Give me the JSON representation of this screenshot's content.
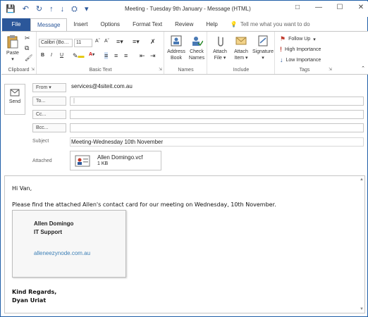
{
  "window": {
    "title": "Meeting - Tuesday 9th January  -  Message (HTML)",
    "controls": [
      "restore-down-icon",
      "minimize-icon",
      "maximize-icon",
      "close-icon"
    ]
  },
  "qat": [
    "save-icon",
    "undo-icon",
    "redo-icon",
    "up-arrow-icon",
    "down-arrow-icon",
    "attach-icon",
    "more-icon"
  ],
  "tabs": [
    {
      "label": "File"
    },
    {
      "label": "Message"
    },
    {
      "label": "Insert"
    },
    {
      "label": "Options"
    },
    {
      "label": "Format Text"
    },
    {
      "label": "Review"
    },
    {
      "label": "Help"
    }
  ],
  "tell_me": "Tell me what you want to do",
  "ribbon": {
    "clipboard": {
      "label": "Clipboard",
      "paste": "Paste"
    },
    "basic_text": {
      "label": "Basic Text",
      "font": "Calibri (Bo…",
      "size": "11"
    },
    "names": {
      "label": "Names",
      "address_book": "Address Book",
      "check_names": "Check Names"
    },
    "include": {
      "label": "Include",
      "attach_file": "Attach File",
      "attach_item": "Attach Item",
      "signature": "Signature"
    },
    "tags": {
      "label": "Tags",
      "follow_up": "Follow Up",
      "high": "High Importance",
      "low": "Low Importance"
    }
  },
  "header": {
    "send": "Send",
    "from_label": "From",
    "from_value": "services@4siteit.com.au",
    "to_label": "To...",
    "cc_label": "Cc...",
    "bcc_label": "Bcc...",
    "subject_label": "Subject",
    "subject_value": "Meeting-Wednesday 10th November",
    "attached_label": "Attached",
    "attachment": {
      "name": "Allen Domingo.vcf",
      "size": "1 KB"
    }
  },
  "body": {
    "greeting": "Hi Van,",
    "message": "Please find the attached Allen's contact card for our meeting on Wednesday, 10th November.",
    "card": {
      "name": "Allen Domingo",
      "role": "IT Support",
      "website": "alleneezynode.com.au"
    },
    "sign_off": "Kind Regards,",
    "sender": "Dyan Uriat"
  },
  "colors": {
    "accent": "#2b579a",
    "link": "#3c7fb6",
    "flag": "#c0392b"
  }
}
